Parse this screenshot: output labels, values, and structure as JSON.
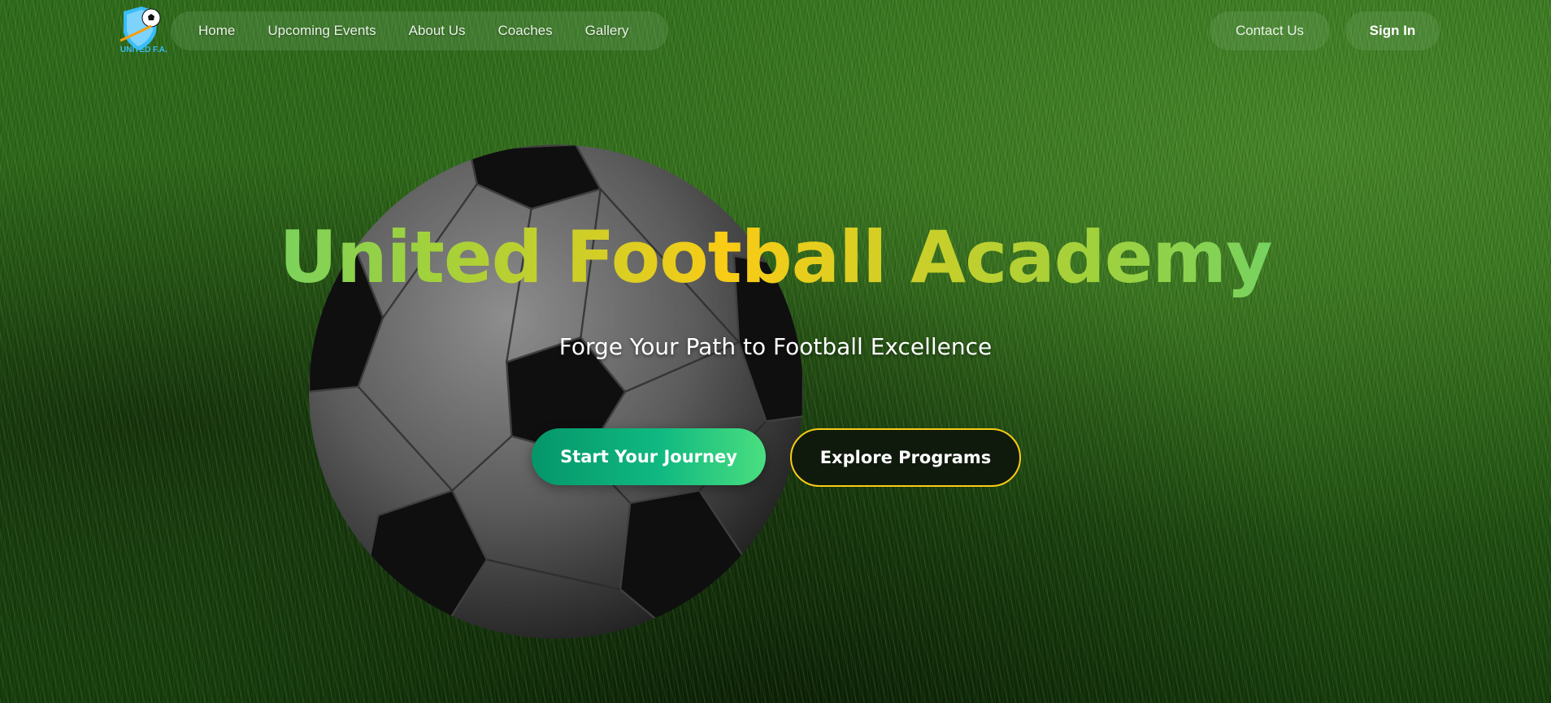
{
  "brand": {
    "logo_text": "UNITED F.A."
  },
  "nav": {
    "links": [
      {
        "label": "Home"
      },
      {
        "label": "Upcoming Events"
      },
      {
        "label": "About Us"
      },
      {
        "label": "Coaches"
      },
      {
        "label": "Gallery"
      }
    ],
    "contact_label": "Contact Us",
    "signin_label": "Sign In"
  },
  "hero": {
    "title": "United Football Academy",
    "subtitle": "Forge Your Path to Football Excellence",
    "primary_cta": "Start Your Journey",
    "secondary_cta": "Explore Programs"
  },
  "colors": {
    "accent_green": "#10b981",
    "accent_yellow": "#facc15",
    "logo_blue": "#38bdf8"
  }
}
